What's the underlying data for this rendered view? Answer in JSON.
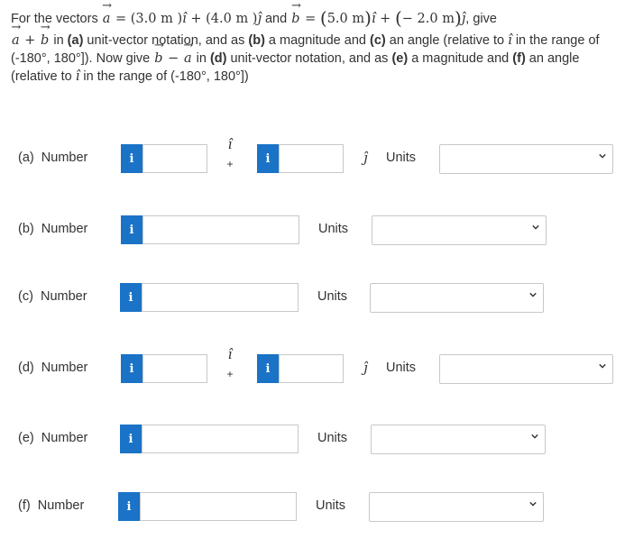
{
  "question": {
    "l1_a": "For the vectors ",
    "vec_a": "a",
    "eq": " = ",
    "a_i_coef": "(3.0 m )",
    "i_hat": "î",
    "plus": " + ",
    "a_j_coef": "(4.0 m )",
    "j_hat": "ĵ",
    "and": " and ",
    "vec_b": "b",
    "b_i_coef": "5.0 m",
    "b_j_coef": "− 2.0 m",
    "l1_end": ", give",
    "l2_a": " in ",
    "l2_pa": "(a)",
    "l2_b": " unit-vector notation, and as ",
    "l2_pb": "(b)",
    "l2_c": " a magnitude and ",
    "l2_pc": "(c)",
    "l2_d": " an angle (relative to ",
    "l2_e": " in the range of (-180°, 180°]). Now give ",
    "minus": " − ",
    "l3_a": " in ",
    "l3_pd": "(d)",
    "l3_b": " unit-vector notation, and as ",
    "l3_pe": "(e)",
    "l3_c": " a magnitude and ",
    "l3_pf": "(f)",
    "l3_d": " an angle (relative to ",
    "l3_e": " in the range of (-180°, 180°])"
  },
  "parts": [
    {
      "id": "a",
      "label": "(a)",
      "number": "Number",
      "info": "i",
      "i_hat": "î",
      "plus": "+",
      "j_hat": "ĵ",
      "units": "Units"
    },
    {
      "id": "b",
      "label": "(b)",
      "number": "Number",
      "info": "i",
      "units": "Units"
    },
    {
      "id": "c",
      "label": "(c)",
      "number": "Number",
      "info": "i",
      "units": "Units"
    },
    {
      "id": "d",
      "label": "(d)",
      "number": "Number",
      "info": "i",
      "i_hat": "î",
      "plus": "+",
      "j_hat": "ĵ",
      "units": "Units"
    },
    {
      "id": "e",
      "label": "(e)",
      "number": "Number",
      "info": "i",
      "units": "Units"
    },
    {
      "id": "f",
      "label": "(f)",
      "number": "Number",
      "info": "i",
      "units": "Units"
    }
  ],
  "colors": {
    "info_button": "#1a73c6",
    "border": "#c8c8c8",
    "text": "#333333"
  }
}
